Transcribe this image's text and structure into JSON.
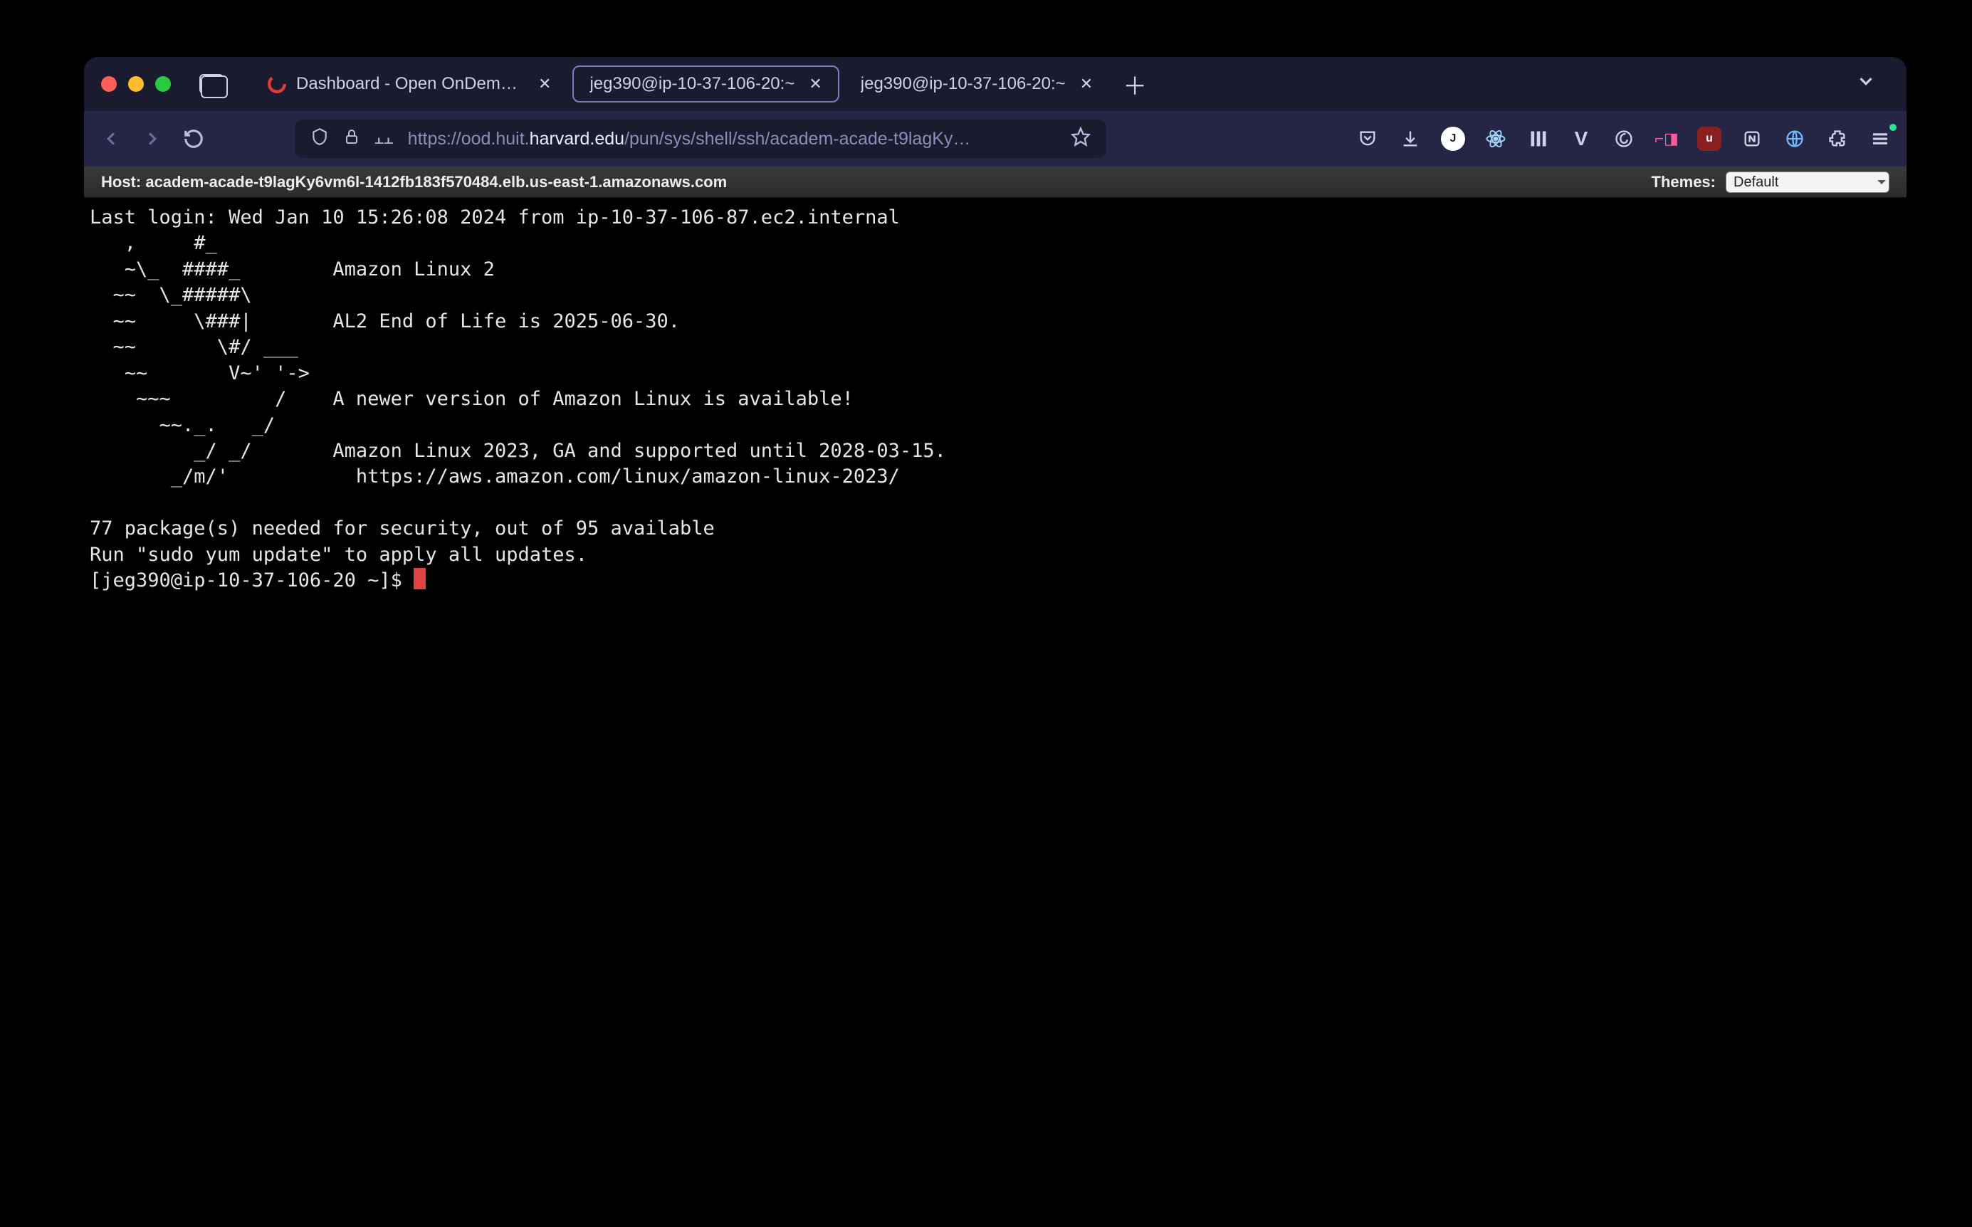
{
  "tabs": {
    "t1": {
      "label": "Dashboard - Open OnDemand"
    },
    "t2": {
      "label": "jeg390@ip-10-37-106-20:~"
    },
    "t3": {
      "label": "jeg390@ip-10-37-106-20:~"
    }
  },
  "url": {
    "prefix": "https://ood.huit.",
    "host": "harvard.edu",
    "path": "/pun/sys/shell/ssh/academ-acade-t9lagKy…"
  },
  "hostbar": {
    "host_label": "Host: ",
    "host": "academ-acade-t9lagKy6vm6l-1412fb183f570484.elb.us-east-1.amazonaws.com",
    "themes_label": "Themes:",
    "theme_selected": "Default"
  },
  "terminal": {
    "motd": "Last login: Wed Jan 10 15:26:08 2024 from ip-10-37-106-87.ec2.internal\n   ,     #_\n   ~\\_  ####_        Amazon Linux 2\n  ~~  \\_#####\\\n  ~~     \\###|       AL2 End of Life is 2025-06-30.\n  ~~       \\#/ ___\n   ~~       V~' '->\n    ~~~         /    A newer version of Amazon Linux is available!\n      ~~._.   _/\n         _/ _/       Amazon Linux 2023, GA and supported until 2028-03-15.\n       _/m/'           https://aws.amazon.com/linux/amazon-linux-2023/\n\n77 package(s) needed for security, out of 95 available\nRun \"sudo yum update\" to apply all updates.",
    "prompt": "[jeg390@ip-10-37-106-20 ~]$ "
  }
}
